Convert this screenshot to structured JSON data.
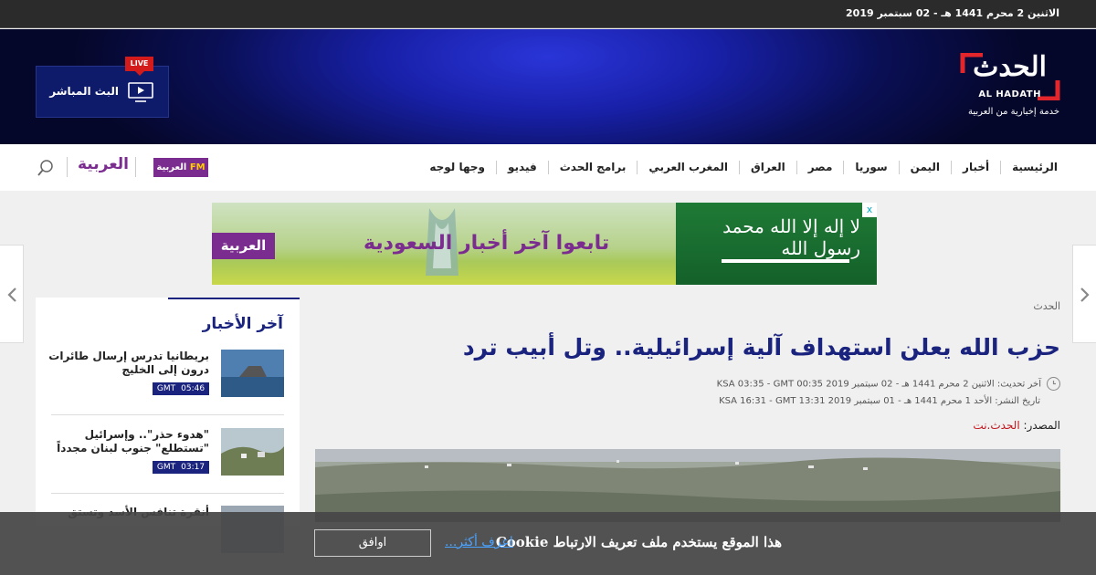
{
  "topbar": {
    "date": "الاثنين 2 محرم 1441 هـ - 02 سبتمبر 2019"
  },
  "header": {
    "logo_word": "الحدث",
    "logo_latin": "AL HADATH",
    "logo_tagline": "خدمة إخبارية من العربية",
    "live_label": "البث المباشر",
    "live_badge": "LIVE",
    "colors": {
      "accent_red": "#d31b1b",
      "header_blue": "#1820a8"
    }
  },
  "nav": {
    "items": [
      "الرئيسية",
      "أخبار",
      "اليمن",
      "سوريا",
      "مصر",
      "العراق",
      "المغرب العربي",
      "برامج الحدث",
      "فيديو",
      "وجها لوجه"
    ],
    "brand_arabiya": "العربية",
    "brand_fm_word": "العربية",
    "brand_fm_suffix": "FM",
    "search_icon": "search-icon"
  },
  "ad": {
    "headline": "تابعوا آخر أخبار السعودية",
    "logo": "العربية",
    "flag_text": "لا إله إلا الله محمد رسول الله",
    "close_icon": "x"
  },
  "article": {
    "breadcrumb": "الحدث",
    "title": "حزب الله يعلن استهداف آلية إسرائيلية.. وتل أبيب ترد",
    "updated": "آخر تحديث: الاثنين 2 محرم 1441 هـ - 02 سبتمبر 2019 KSA 03:35 - GMT 00:35",
    "published": "تاريخ النشر: الأحد 1 محرم 1441 هـ - 01 سبتمبر 2019 KSA 16:31 - GMT 13:31",
    "source_label": "المصدر:",
    "source_value": "الحدث.نت"
  },
  "latest": {
    "heading": "آخر الأخبار",
    "items": [
      {
        "text": "بريطانيا تدرس إرسال طائرات درون إلى الخليج",
        "time": "05:46",
        "tz": "GMT"
      },
      {
        "text": "\"هدوء حذر\".. وإسرائيل \"تستطلع\" جنوب لبنان مجدداً",
        "time": "03:17",
        "tz": "GMT"
      },
      {
        "text": "أنقرة تنافس الأسد وتستق",
        "time": "",
        "tz": ""
      }
    ]
  },
  "cookie": {
    "message": "هذا الموقع يستخدم ملف تعريف الارتباط Cookie",
    "more": "اعرف أكثر...",
    "accept": "اوافق"
  }
}
